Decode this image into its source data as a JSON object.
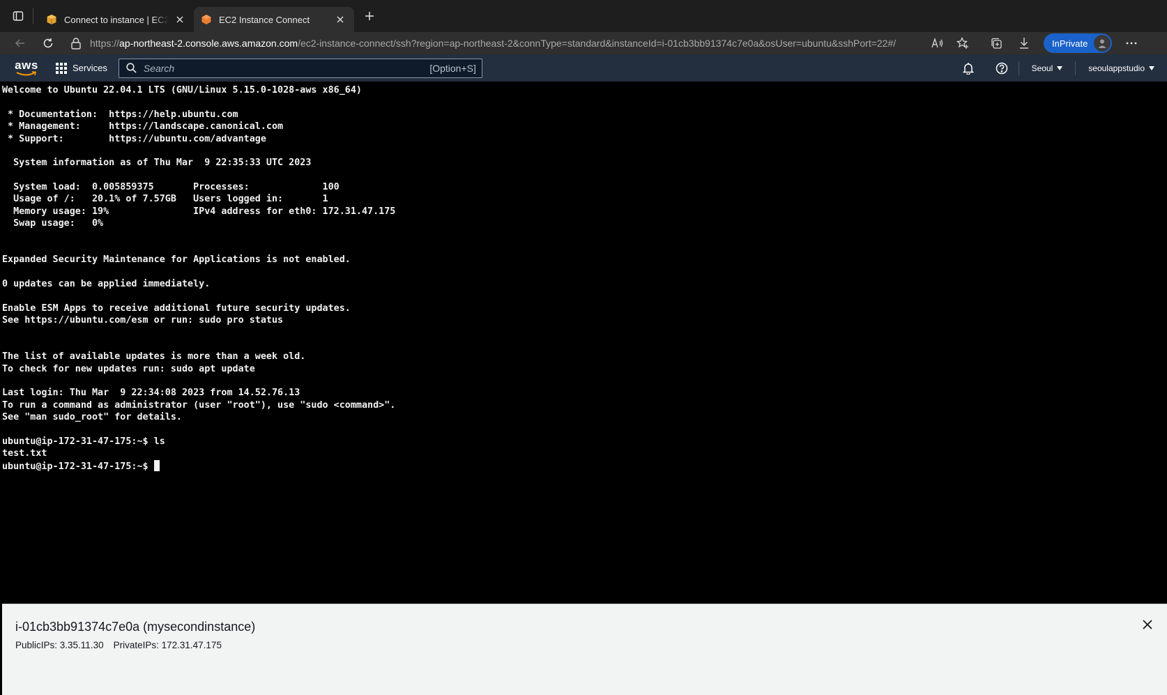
{
  "browser": {
    "tabs": [
      {
        "title": "Connect to instance | EC2 Management Console",
        "active": false,
        "favicon": "aws-box-icon"
      },
      {
        "title": "EC2 Instance Connect",
        "active": true,
        "favicon": "ec2-icon"
      }
    ],
    "url": {
      "prefix": "https://",
      "host": "ap-northeast-2.console.aws.amazon.com",
      "path": "/ec2-instance-connect/ssh?region=ap-northeast-2&connType=standard&instanceId=i-01cb3bb91374c7e0a&osUser=ubuntu&sshPort=22#/"
    },
    "inprivate_label": "InPrivate"
  },
  "aws": {
    "logo_text": "aws",
    "services_label": "Services",
    "search_placeholder": "Search",
    "search_shortcut": "[Option+S]",
    "region": "Seoul",
    "account": "seoulappstudio"
  },
  "terminal": {
    "lines": [
      "Welcome to Ubuntu 22.04.1 LTS (GNU/Linux 5.15.0-1028-aws x86_64)",
      "",
      " * Documentation:  https://help.ubuntu.com",
      " * Management:     https://landscape.canonical.com",
      " * Support:        https://ubuntu.com/advantage",
      "",
      "  System information as of Thu Mar  9 22:35:33 UTC 2023",
      "",
      "  System load:  0.005859375       Processes:             100",
      "  Usage of /:   20.1% of 7.57GB   Users logged in:       1",
      "  Memory usage: 19%               IPv4 address for eth0: 172.31.47.175",
      "  Swap usage:   0%",
      "",
      "",
      "Expanded Security Maintenance for Applications is not enabled.",
      "",
      "0 updates can be applied immediately.",
      "",
      "Enable ESM Apps to receive additional future security updates.",
      "See https://ubuntu.com/esm or run: sudo pro status",
      "",
      "",
      "The list of available updates is more than a week old.",
      "To check for new updates run: sudo apt update",
      "",
      "Last login: Thu Mar  9 22:34:08 2023 from 14.52.76.13",
      "To run a command as administrator (user \"root\"), use \"sudo <command>\".",
      "See \"man sudo_root\" for details.",
      "",
      "ubuntu@ip-172-31-47-175:~$ ls",
      "test.txt",
      "ubuntu@ip-172-31-47-175:~$ "
    ]
  },
  "instance_panel": {
    "title": "i-01cb3bb91374c7e0a (mysecondinstance)",
    "public_ips": "PublicIPs: 3.35.11.30",
    "private_ips": "PrivateIPs: 172.31.47.175"
  }
}
